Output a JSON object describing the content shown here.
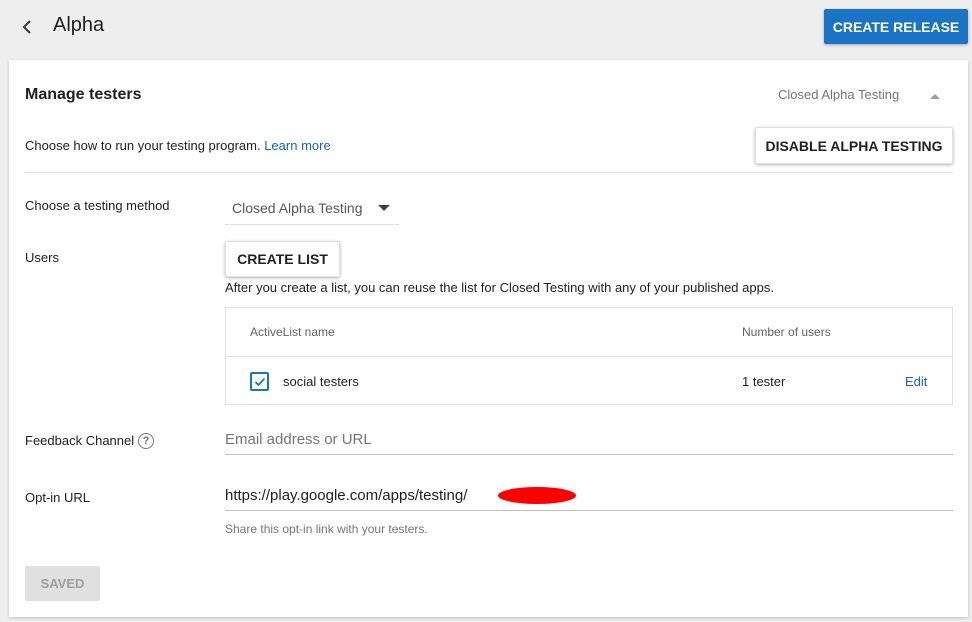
{
  "header": {
    "title": "Alpha",
    "create_release_label": "CREATE RELEASE"
  },
  "card": {
    "title": "Manage testers",
    "status": "Closed Alpha Testing",
    "intro_text": "Choose how to run your testing program.",
    "learn_more": "Learn more",
    "disable_label": "DISABLE ALPHA TESTING"
  },
  "method": {
    "label": "Choose a testing method",
    "selected": "Closed Alpha Testing"
  },
  "users": {
    "label": "Users",
    "create_list_label": "CREATE LIST",
    "hint": "After you create a list, you can reuse the list for Closed Testing with any of your published apps.",
    "table": {
      "headers": [
        "ActiveList name",
        "Number of users"
      ],
      "rows": [
        {
          "name": "social testers",
          "count": "1 tester",
          "action": "Edit",
          "checked": true
        }
      ]
    }
  },
  "feedback": {
    "label": "Feedback Channel",
    "placeholder": "Email address or URL",
    "value": ""
  },
  "optin": {
    "label": "Opt-in URL",
    "value": "https://play.google.com/apps/testing/",
    "hint": "Share this opt-in link with your testers."
  },
  "footer": {
    "saved_label": "SAVED"
  },
  "colors": {
    "primary": "#1a73c4",
    "link": "#1565c0",
    "background": "#eeeeee",
    "redaction": "#ff0000"
  }
}
